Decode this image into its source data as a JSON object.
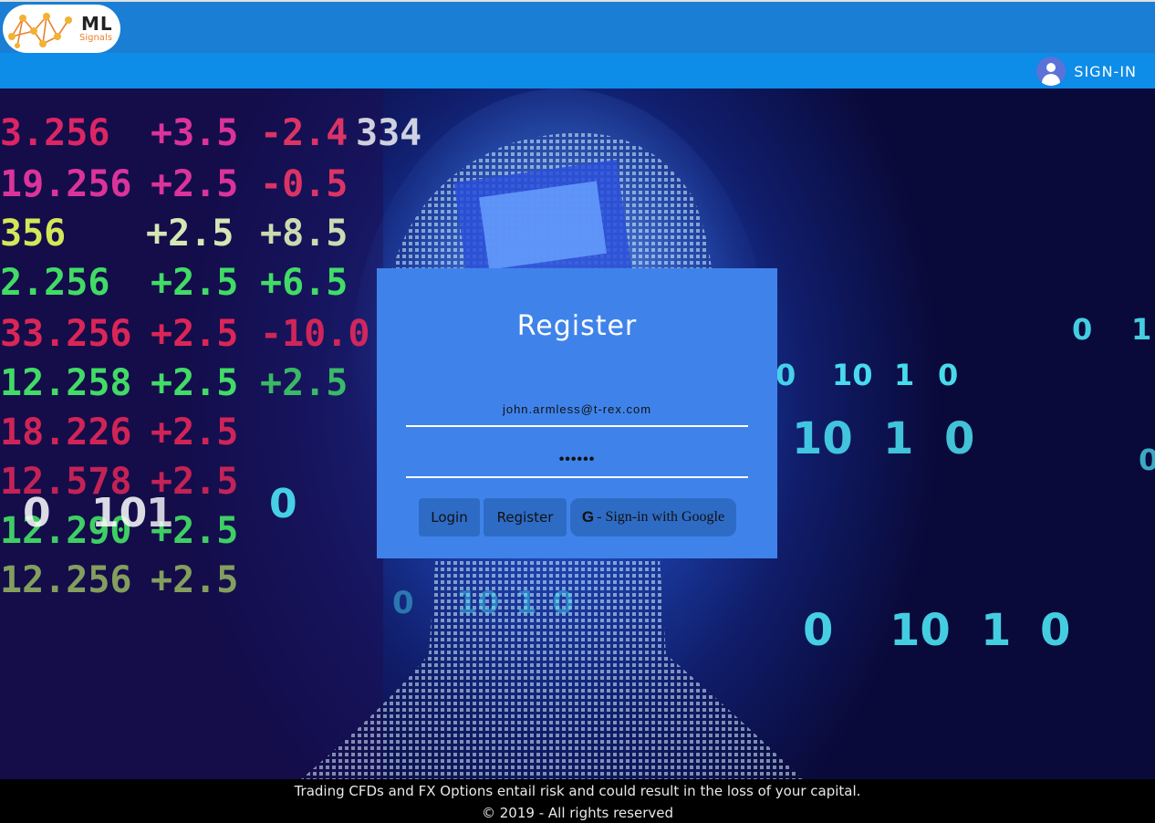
{
  "header": {
    "logo_main": "ML",
    "logo_sub": "Signals"
  },
  "nav": {
    "signin_label": "SIGN-IN"
  },
  "register_form": {
    "title": "Register",
    "email_value": "john.armless@t-rex.com",
    "password_value": "••••••",
    "login_button": "Login",
    "register_button": "Register",
    "google_button": "- Sign-in with Google",
    "google_icon": "G"
  },
  "footer": {
    "disclaimer": "Trading CFDs and FX Options entail risk and could result in the loss of your capital.",
    "copyright": "© 2019 - All rights reserved"
  },
  "colors": {
    "topbar": "#1a7ed4",
    "navbar": "#0d8ce8",
    "card": "#3f83ea",
    "button": "#2e6bc4",
    "footer": "#000000"
  }
}
